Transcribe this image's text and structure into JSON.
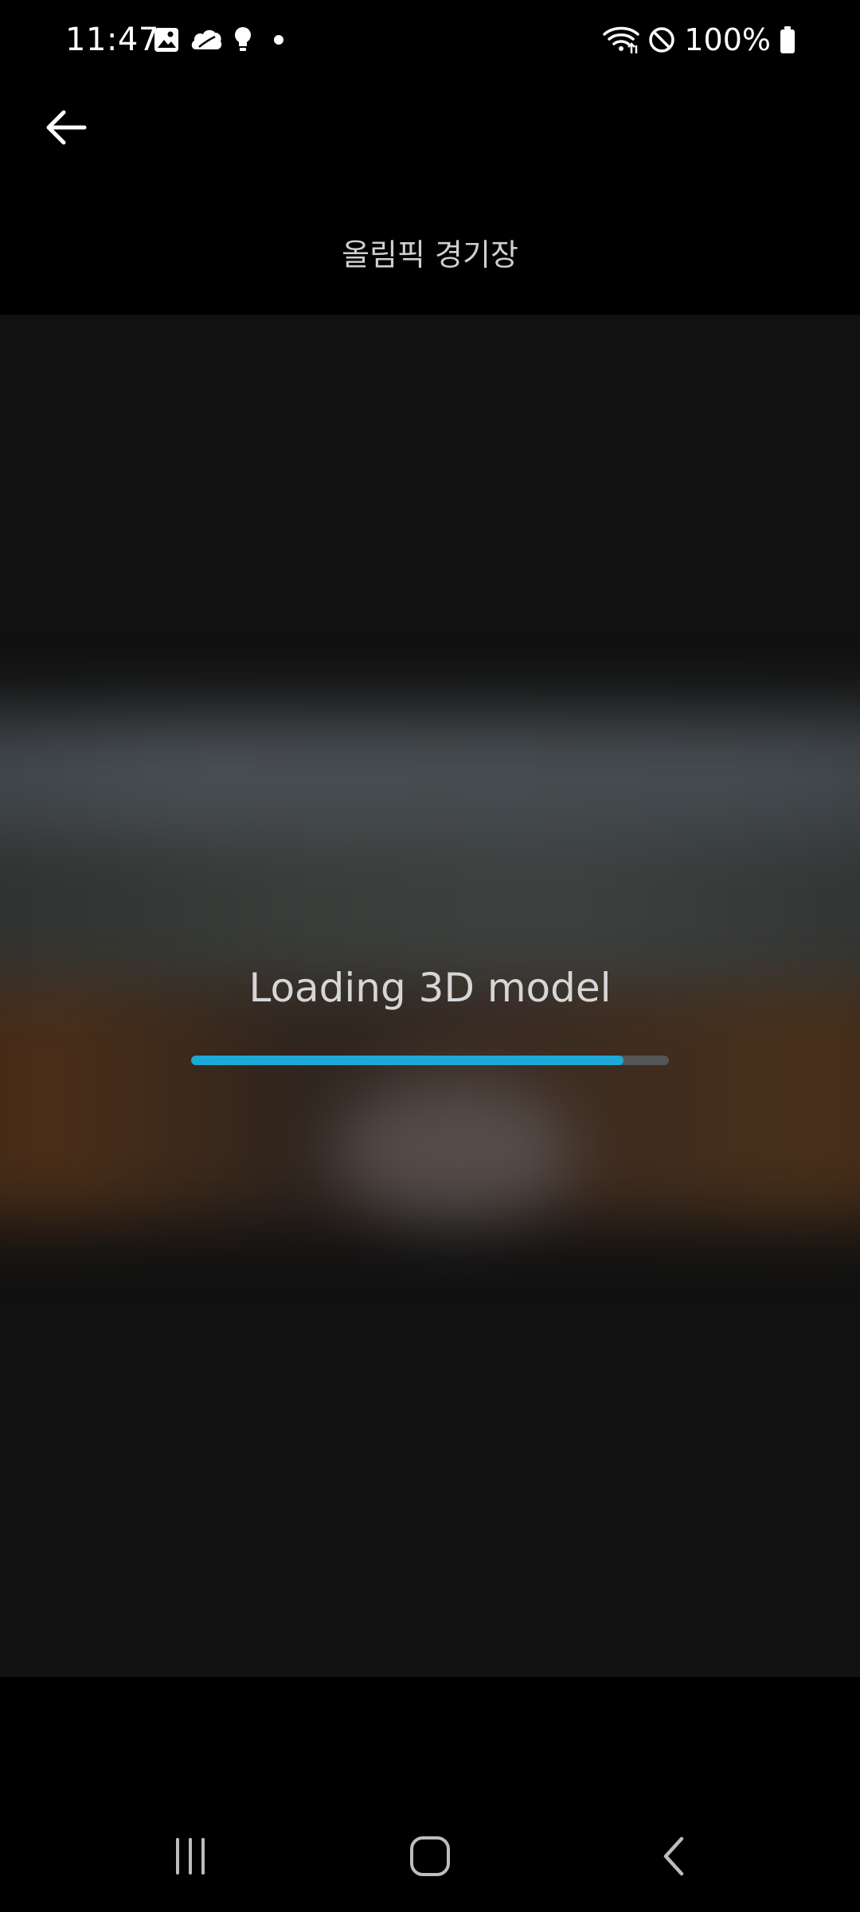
{
  "status_bar": {
    "time": "11:47",
    "left_icons": [
      "gallery-icon",
      "cloud-leaf-icon",
      "bulb-icon",
      "dot-icon"
    ],
    "right_icons": [
      "wifi-icon",
      "do-not-disturb-icon",
      "battery-icon"
    ],
    "battery_text": "100%"
  },
  "header": {
    "back_icon": "arrow-left-icon",
    "title": "올림픽 경기장"
  },
  "viewer": {
    "loading_text": "Loading 3D model",
    "progress_percent": 90.5,
    "progress_color": "#1ea8d8",
    "track_color": "#555555"
  },
  "nav_bar": {
    "items": [
      "recents-icon",
      "home-icon",
      "back-icon"
    ]
  },
  "colors": {
    "background": "#000000",
    "viewer_background": "#111111",
    "title_text": "#cfcfcf",
    "loading_text": "#d6d6d6"
  }
}
